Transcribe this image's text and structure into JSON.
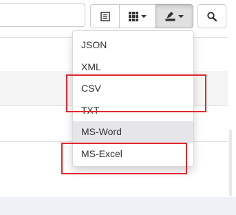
{
  "toolbar": {
    "list_icon": "list-view-icon",
    "columns_icon": "grid-columns-icon",
    "export_icon": "export-download-icon",
    "search_icon": "search-icon"
  },
  "export_menu": {
    "items": [
      {
        "label": "JSON"
      },
      {
        "label": "XML"
      },
      {
        "label": "CSV"
      },
      {
        "label": "TXT"
      },
      {
        "label": "MS-Word",
        "highlighted": true
      },
      {
        "label": "MS-Excel"
      }
    ]
  },
  "colors": {
    "annotation": "#e0282c",
    "hover_bg": "#e6e6ea"
  }
}
